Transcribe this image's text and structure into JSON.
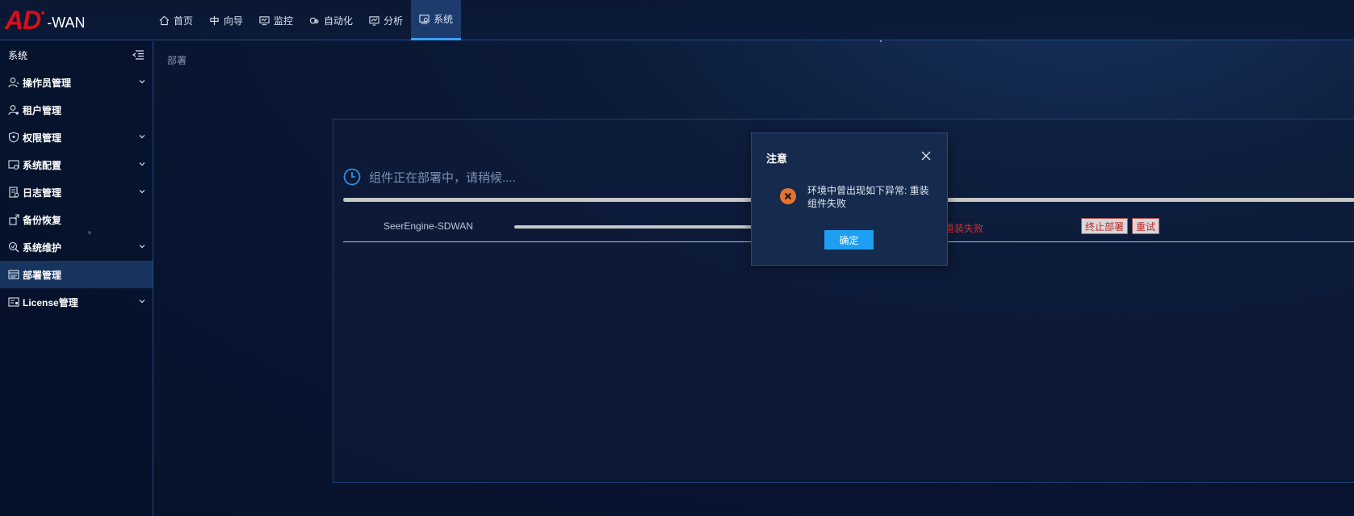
{
  "logo": {
    "brand": "AD",
    "product": "-WAN"
  },
  "nav": [
    {
      "label": "首页",
      "icon": "home-icon"
    },
    {
      "label": "向导",
      "icon": "guide-icon"
    },
    {
      "label": "监控",
      "icon": "monitor-icon"
    },
    {
      "label": "自动化",
      "icon": "automation-icon"
    },
    {
      "label": "分析",
      "icon": "analysis-icon"
    },
    {
      "label": "系统",
      "icon": "system-icon",
      "active": true
    }
  ],
  "sidebar": {
    "title": "系统",
    "items": [
      {
        "label": "操作员管理",
        "icon": "operator-icon",
        "expandable": true
      },
      {
        "label": "租户管理",
        "icon": "tenant-icon",
        "expandable": false
      },
      {
        "label": "权限管理",
        "icon": "permission-icon",
        "expandable": true
      },
      {
        "label": "系统配置",
        "icon": "config-icon",
        "expandable": true
      },
      {
        "label": "日志管理",
        "icon": "log-icon",
        "expandable": true
      },
      {
        "label": "备份恢复",
        "icon": "backup-icon",
        "expandable": false
      },
      {
        "label": "系统维护",
        "icon": "maintenance-icon",
        "expandable": true
      },
      {
        "label": "部署管理",
        "icon": "deploy-icon",
        "expandable": false,
        "active": true
      },
      {
        "label": "License管理",
        "icon": "license-icon",
        "expandable": true
      }
    ]
  },
  "breadcrumb": "部署",
  "deploy": {
    "status_text": "组件正在部署中，请稍候....",
    "component": "SeerEngine-SDWAN",
    "component_status": "重装失败",
    "stop_label": "终止部署",
    "retry_label": "重试"
  },
  "dialog": {
    "title": "注意",
    "message": "环境中曾出现如下异常: 重装组件失败",
    "ok_label": "确定"
  },
  "colors": {
    "accent": "#1e9ff2",
    "brand_red": "#d4101c",
    "error_orange": "#e8732e",
    "error_text": "#d03030"
  }
}
